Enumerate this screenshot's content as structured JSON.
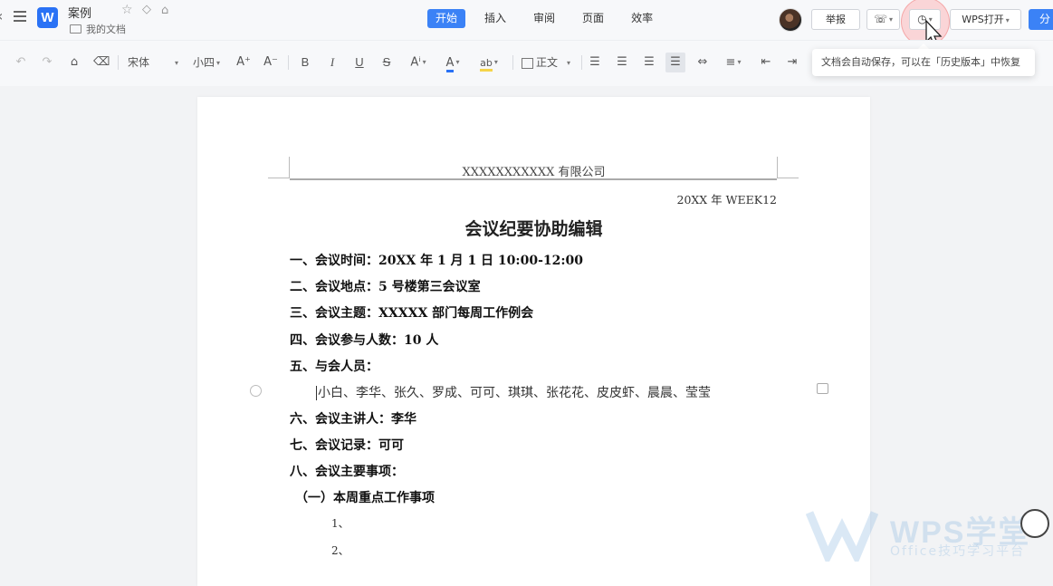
{
  "app": {
    "title": "案例",
    "folder": "我的文档",
    "logo_letter": "W"
  },
  "tabs": [
    {
      "label": "开始",
      "active": true
    },
    {
      "label": "插入",
      "active": false
    },
    {
      "label": "审阅",
      "active": false
    },
    {
      "label": "页面",
      "active": false
    },
    {
      "label": "效率",
      "active": false
    }
  ],
  "header_buttons": {
    "report": "举报",
    "wps_open": "WPS打开",
    "share": "分"
  },
  "toolbar": {
    "font_name": "宋体",
    "font_size": "小四",
    "grow": "A⁺",
    "shrink": "A⁻",
    "bold": "B",
    "italic": "I",
    "underline": "U",
    "strike": "S",
    "style": "正文"
  },
  "tooltip": "文档会自动保存，可以在「历史版本」中恢复",
  "document": {
    "header_company": "XXXXXXXXXXX 有限公司",
    "week": "20XX 年 WEEK12",
    "title": "会议纪要协助编辑",
    "lines": [
      "一、会议时间：20XX 年 1 月 1 日  10:00-12:00",
      "二、会议地点：5 号楼第三会议室",
      "三、会议主题：XXXXX 部门每周工作例会",
      "四、会议参与人数：10 人",
      "五、与会人员：",
      "小白、李华、张久、罗成、可可、琪琪、张花花、皮皮虾、晨晨、莹莹",
      "六、会议主讲人：李华",
      "七、会议记录：可可",
      "八、会议主要事项：",
      "（一）本周重点工作事项",
      "1、",
      "2、"
    ]
  },
  "watermark": {
    "brand": "WPS学堂",
    "sub": "Office技巧学习平台"
  },
  "colors": {
    "accent": "#3b82f6",
    "highlight": "#f08a8a"
  }
}
